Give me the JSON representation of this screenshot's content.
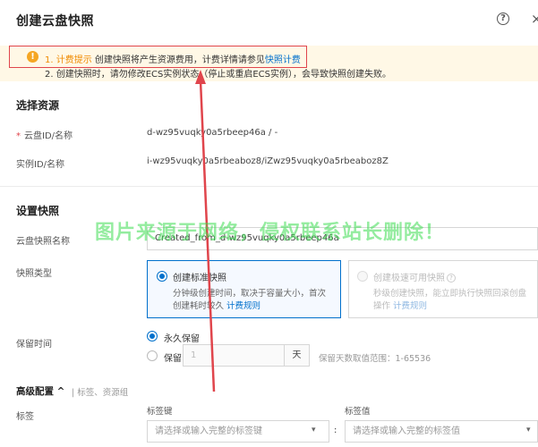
{
  "header": {
    "title": "创建云盘快照",
    "help_glyph": "?",
    "close_glyph": "×"
  },
  "notice": {
    "icon": "warning-icon",
    "line1_tag": "1. 计费提示",
    "line1_text": "创建快照将产生资源费用，计费详情请参见",
    "line1_link": "快照计费",
    "line2_text": "2. 创建快照时，请勿修改ECS实例状态（停止或重启ECS实例），会导致快照创建失败。"
  },
  "select_resource": {
    "title": "选择资源",
    "disk_label": "云盘ID/名称",
    "disk_value": "d-wz95vuqky0a5rbeep46a / -",
    "instance_label": "实例ID/名称",
    "instance_value": "i-wz95vuqky0a5rbeaboz8/iZwz95vuqky0a5rbeaboz8Z"
  },
  "settings": {
    "title": "设置快照",
    "name_label": "云盘快照名称",
    "name_value": "Created_from_d-wz95vuqky0a5rbeep46a",
    "type_label": "快照类型",
    "standard": {
      "title": "创建标准快照",
      "desc1": "分钟级创建时间，取决于容量大小，首次",
      "desc2": "创建耗时较久",
      "link": "计费规则"
    },
    "fast": {
      "title": "创建极速可用快照",
      "desc1": "秒级创建快照，能立即执行快照回滚创盘",
      "desc2": "操作",
      "link": "计费规则"
    },
    "retention_label": "保留时间",
    "retention_forever": "永久保留",
    "retention_keep": "保留",
    "retention_days_placeholder": "1",
    "retention_unit": "天",
    "retention_hint": "保留天数取值范围：1-65536"
  },
  "advanced": {
    "title": "高级配置",
    "chevron": "^",
    "subtitle": "| 标签、资源组",
    "tag_label": "标签",
    "key_header": "标签键",
    "value_header": "标签值",
    "key_placeholder": "请选择或输入完整的标签键",
    "value_placeholder": "请选择或输入完整的标签值",
    "separator": ":"
  },
  "watermark": "图片来源于网络，侵权联系站长删除！",
  "colors": {
    "accent": "#0070cc",
    "warning": "#f5a623",
    "annotation_red": "#e0454c",
    "watermark_green": "#3cdc50"
  }
}
